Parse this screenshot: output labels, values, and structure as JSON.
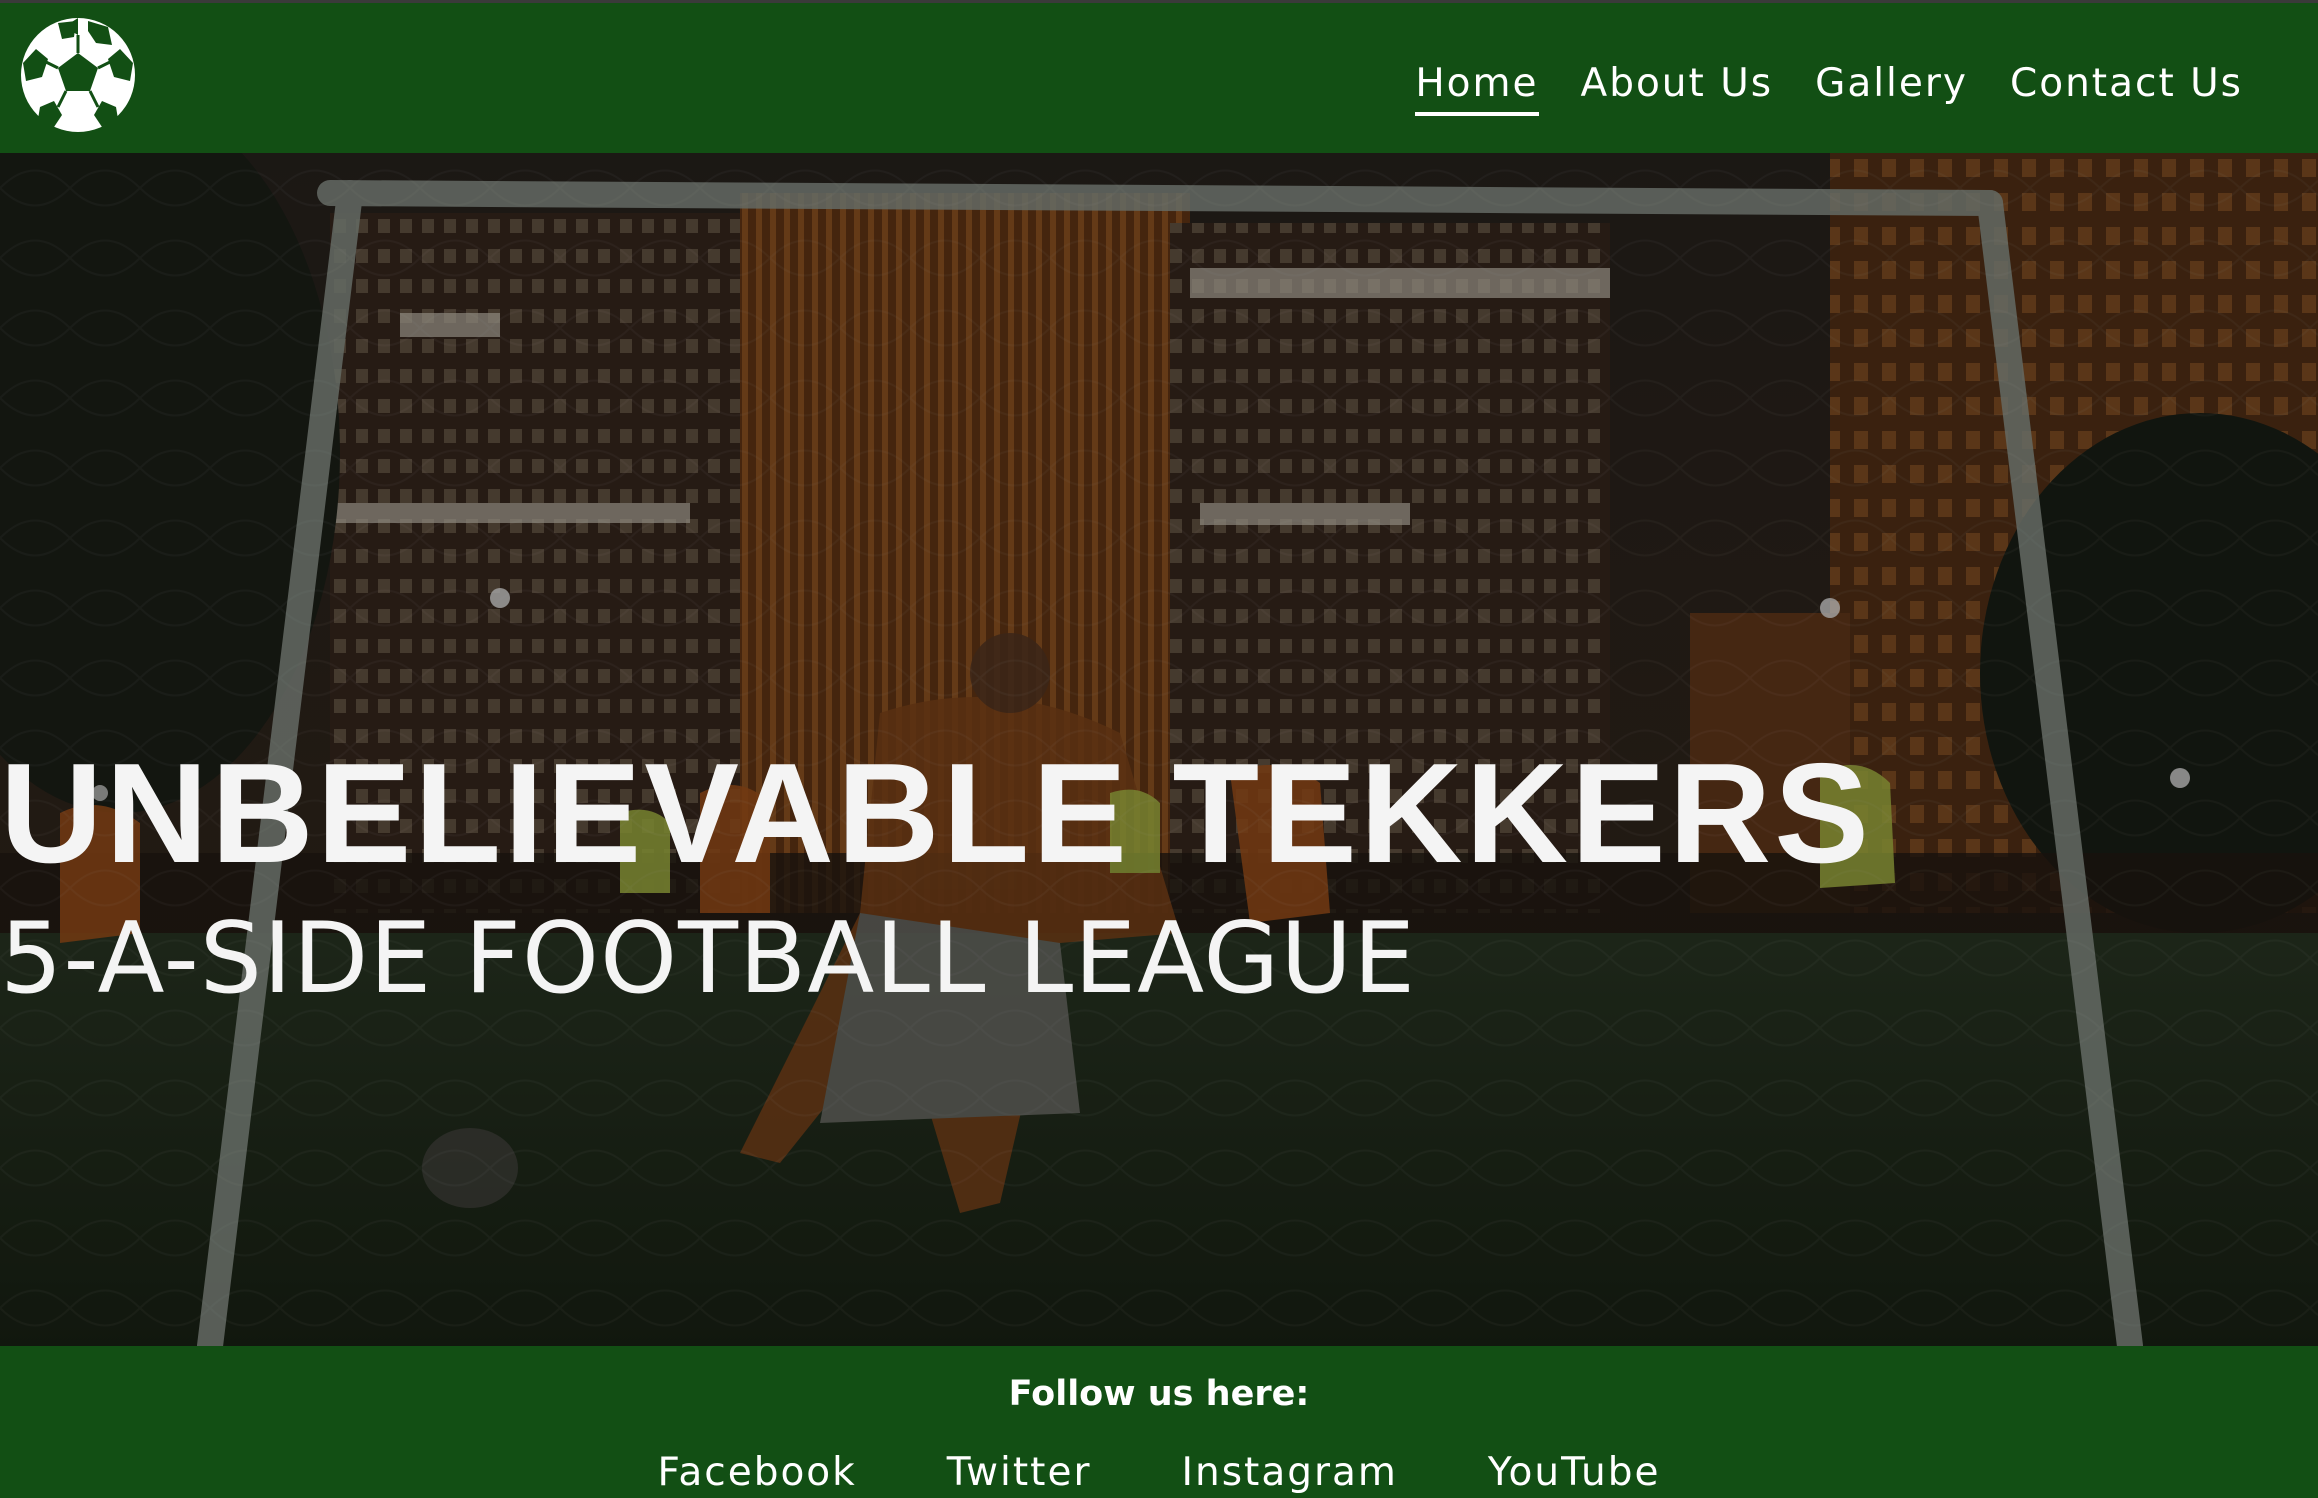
{
  "header": {
    "logo_icon": "soccer-ball-icon",
    "nav": [
      {
        "label": "Home",
        "active": true
      },
      {
        "label": "About Us",
        "active": false
      },
      {
        "label": "Gallery",
        "active": false
      },
      {
        "label": "Contact Us",
        "active": false
      }
    ]
  },
  "hero": {
    "title": "UNBELIEVABLE TEKKERS",
    "subtitle": "5-A-SIDE FOOTBALL LEAGUE"
  },
  "footer": {
    "follow_label": "Follow us here:",
    "links": [
      "Facebook",
      "Twitter",
      "Instagram",
      "YouTube"
    ]
  },
  "colors": {
    "brand_green": "#124f14",
    "text": "#ffffff"
  }
}
